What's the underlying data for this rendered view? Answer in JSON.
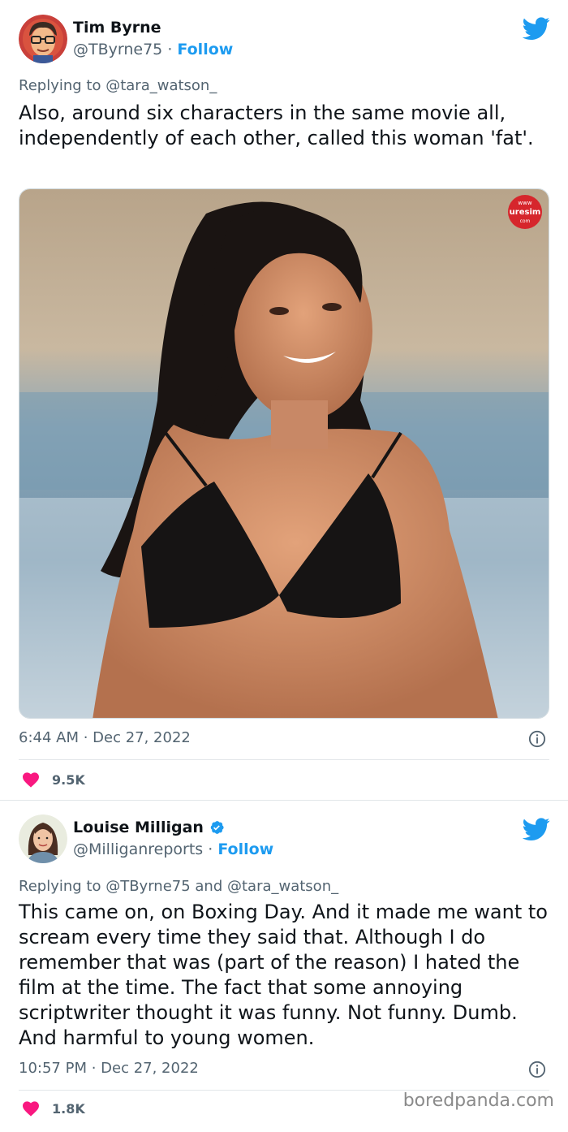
{
  "tweets": [
    {
      "display_name": "Tim Byrne",
      "handle": "@TByrne75",
      "separator": "·",
      "follow_label": "Follow",
      "reply_prefix": "Replying to ",
      "reply_mentions": "@tara_watson_",
      "text": "Also, around six characters in the same movie all, independently of each other, called this woman 'fat'.",
      "media_watermark": [
        "www",
        "uresim",
        "com"
      ],
      "timestamp": "6:44 AM · Dec 27, 2022",
      "like_count": "9.5K"
    },
    {
      "display_name": "Louise Milligan",
      "verified": true,
      "handle": "@Milliganreports",
      "separator": "·",
      "follow_label": "Follow",
      "reply_prefix": "Replying to ",
      "reply_mentions": "@TByrne75 and @tara_watson_",
      "text": "This came on, on Boxing Day. And it made me want to scream every time they said that. Although I do remember that was (part of the reason) I hated the film at the time. The fact that some annoying scriptwriter thought it was funny. Not funny. Dumb. And harmful to young women.",
      "timestamp": "10:57 PM · Dec 27, 2022",
      "like_count": "1.8K"
    }
  ],
  "watermark": "boredpanda.com",
  "colors": {
    "link_blue": "#1d9bf0",
    "text": "#0f1419",
    "secondary": "#536471",
    "heart": "#f91880"
  },
  "icons": [
    "twitter-bird-icon",
    "info-icon",
    "heart-icon",
    "verified-badge-icon"
  ]
}
